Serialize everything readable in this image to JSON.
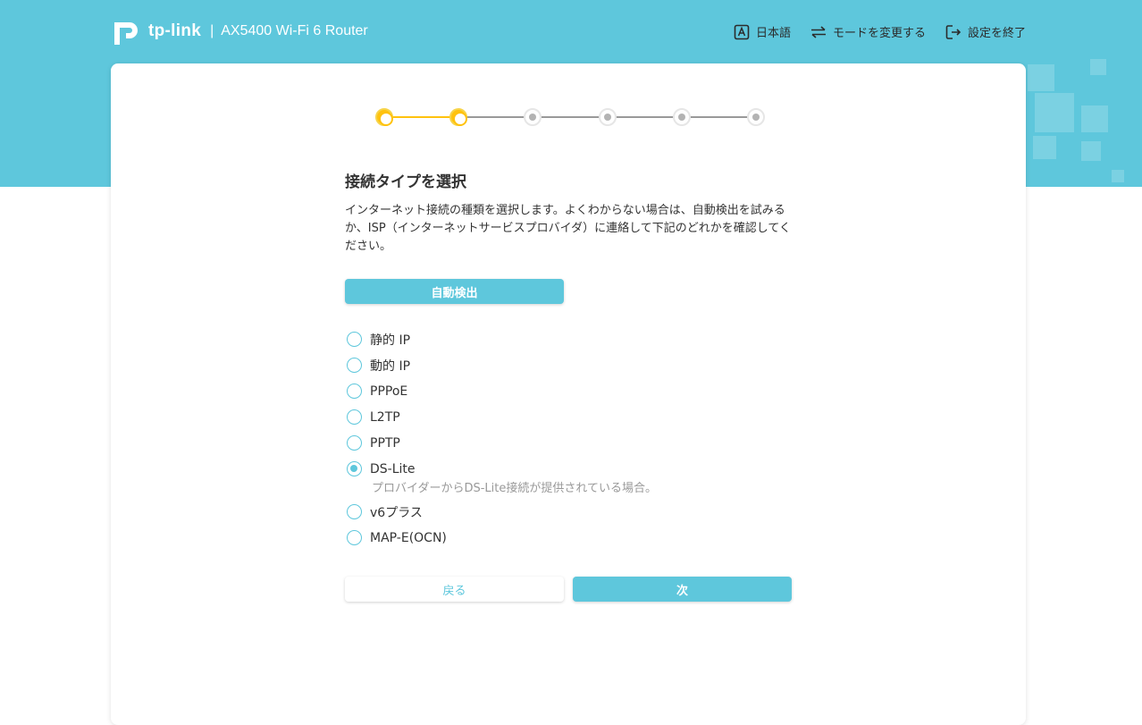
{
  "header": {
    "brand": "tp-link",
    "separator": "|",
    "model": "AX5400 Wi-Fi 6 Router",
    "nav": [
      {
        "label": "日本語",
        "icon": "language-icon"
      },
      {
        "label": "モードを変更する",
        "icon": "switch-mode-icon"
      },
      {
        "label": "設定を終了",
        "icon": "exit-icon"
      }
    ]
  },
  "stepper": {
    "total_steps": 6,
    "current_step": 2,
    "active_color": "#ffc20e",
    "inactive_color": "#b3b3b3"
  },
  "main": {
    "title": "接続タイプを選択",
    "description": "インターネット接続の種類を選択します。よくわからない場合は、自動検出を試みるか、ISP（インターネットサービスプロバイダ）に連絡して下記のどれかを確認してください。",
    "auto_detect_label": "自動検出",
    "options": [
      {
        "label": "静的 IP",
        "checked": false
      },
      {
        "label": "動的 IP",
        "checked": false
      },
      {
        "label": "PPPoE",
        "checked": false
      },
      {
        "label": "L2TP",
        "checked": false
      },
      {
        "label": "PPTP",
        "checked": false
      },
      {
        "label": "DS-Lite",
        "checked": true
      },
      {
        "label": "v6プラス",
        "checked": false
      },
      {
        "label": "MAP-E(OCN)",
        "checked": false
      }
    ],
    "selected_hint": "プロバイダーからDS-Lite接続が提供されている場合。",
    "back_label": "戻る",
    "next_label": "次"
  },
  "colors": {
    "accent": "#5ec7dc",
    "step_active": "#ffc20e"
  }
}
